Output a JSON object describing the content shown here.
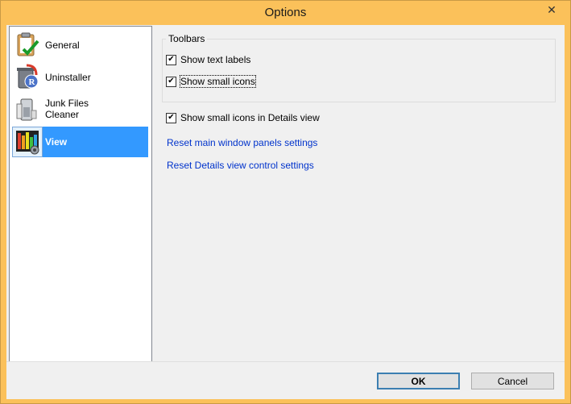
{
  "window": {
    "title": "Options",
    "close_glyph": "✕"
  },
  "sidebar": {
    "items": [
      {
        "label": "General",
        "icon": "clipboard-check-icon",
        "selected": false
      },
      {
        "label": "Uninstaller",
        "icon": "trash-uninstaller-icon",
        "selected": false
      },
      {
        "label_line1": "Junk Files",
        "label_line2": "Cleaner",
        "icon": "junk-files-icon",
        "selected": false
      },
      {
        "label": "View",
        "icon": "view-equalizer-icon",
        "selected": true
      }
    ]
  },
  "toolbars": {
    "group_title": "Toolbars",
    "show_text_labels": {
      "label": "Show text labels",
      "checked": true
    },
    "show_small_icons": {
      "label": "Show small icons",
      "checked": true
    }
  },
  "details": {
    "show_small_icons_details": {
      "label": "Show small icons in Details view",
      "checked": true
    }
  },
  "links": {
    "reset_panels": "Reset main window panels settings",
    "reset_details": "Reset Details view control settings"
  },
  "buttons": {
    "ok": "OK",
    "cancel": "Cancel"
  },
  "check_glyph": "✔",
  "colors": {
    "frame": "#fbc15a",
    "selection": "#3399ff",
    "link": "#0033cc"
  }
}
